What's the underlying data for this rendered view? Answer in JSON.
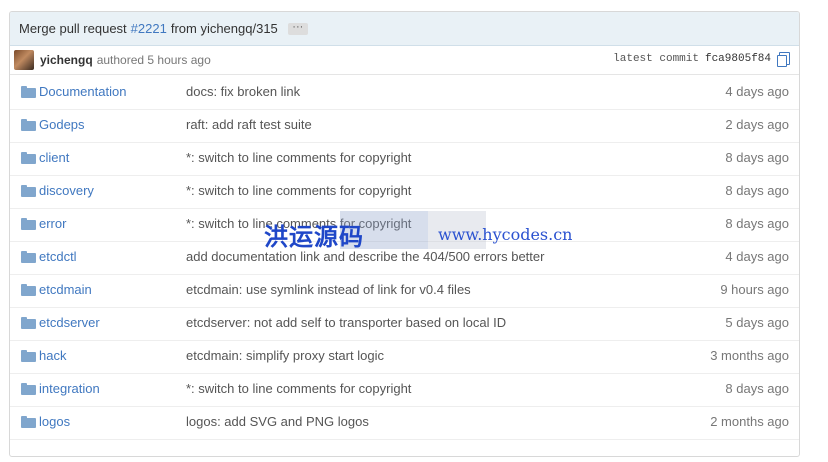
{
  "commit": {
    "title_prefix": "Merge pull request",
    "pr_number": "#2221",
    "title_suffix": "from yichengq/315",
    "dots": "···",
    "author": "yichengq",
    "authored": "authored 5 hours ago",
    "latest_label": "latest commit",
    "sha": "fca9805f84"
  },
  "files": [
    {
      "name": "Documentation",
      "message": "docs: fix broken link",
      "age": "4 days ago"
    },
    {
      "name": "Godeps",
      "message": "raft: add raft test suite",
      "age": "2 days ago"
    },
    {
      "name": "client",
      "message": "*: switch to line comments for copyright",
      "age": "8 days ago"
    },
    {
      "name": "discovery",
      "message": "*: switch to line comments for copyright",
      "age": "8 days ago"
    },
    {
      "name": "error",
      "message": "*: switch to line comments for copyright",
      "age": "8 days ago"
    },
    {
      "name": "etcdctl",
      "message": "add documentation link and describe the 404/500 errors better",
      "age": "4 days ago"
    },
    {
      "name": "etcdmain",
      "message": "etcdmain: use symlink instead of link for v0.4 files",
      "age": "9 hours ago"
    },
    {
      "name": "etcdserver",
      "message": "etcdserver: not add self to transporter based on local ID",
      "age": "5 days ago"
    },
    {
      "name": "hack",
      "message": "etcdmain: simplify proxy start logic",
      "age": "3 months ago"
    },
    {
      "name": "integration",
      "message": "*: switch to line comments for copyright",
      "age": "8 days ago"
    },
    {
      "name": "logos",
      "message": "logos: add SVG and PNG logos",
      "age": "2 months ago"
    }
  ],
  "watermark": {
    "cn": "洪运源码",
    "url": "www.hycodes.cn"
  },
  "colors": {
    "link": "#4078c0",
    "folder": "#80a6cd",
    "header_bg": "#e9f1f6"
  }
}
